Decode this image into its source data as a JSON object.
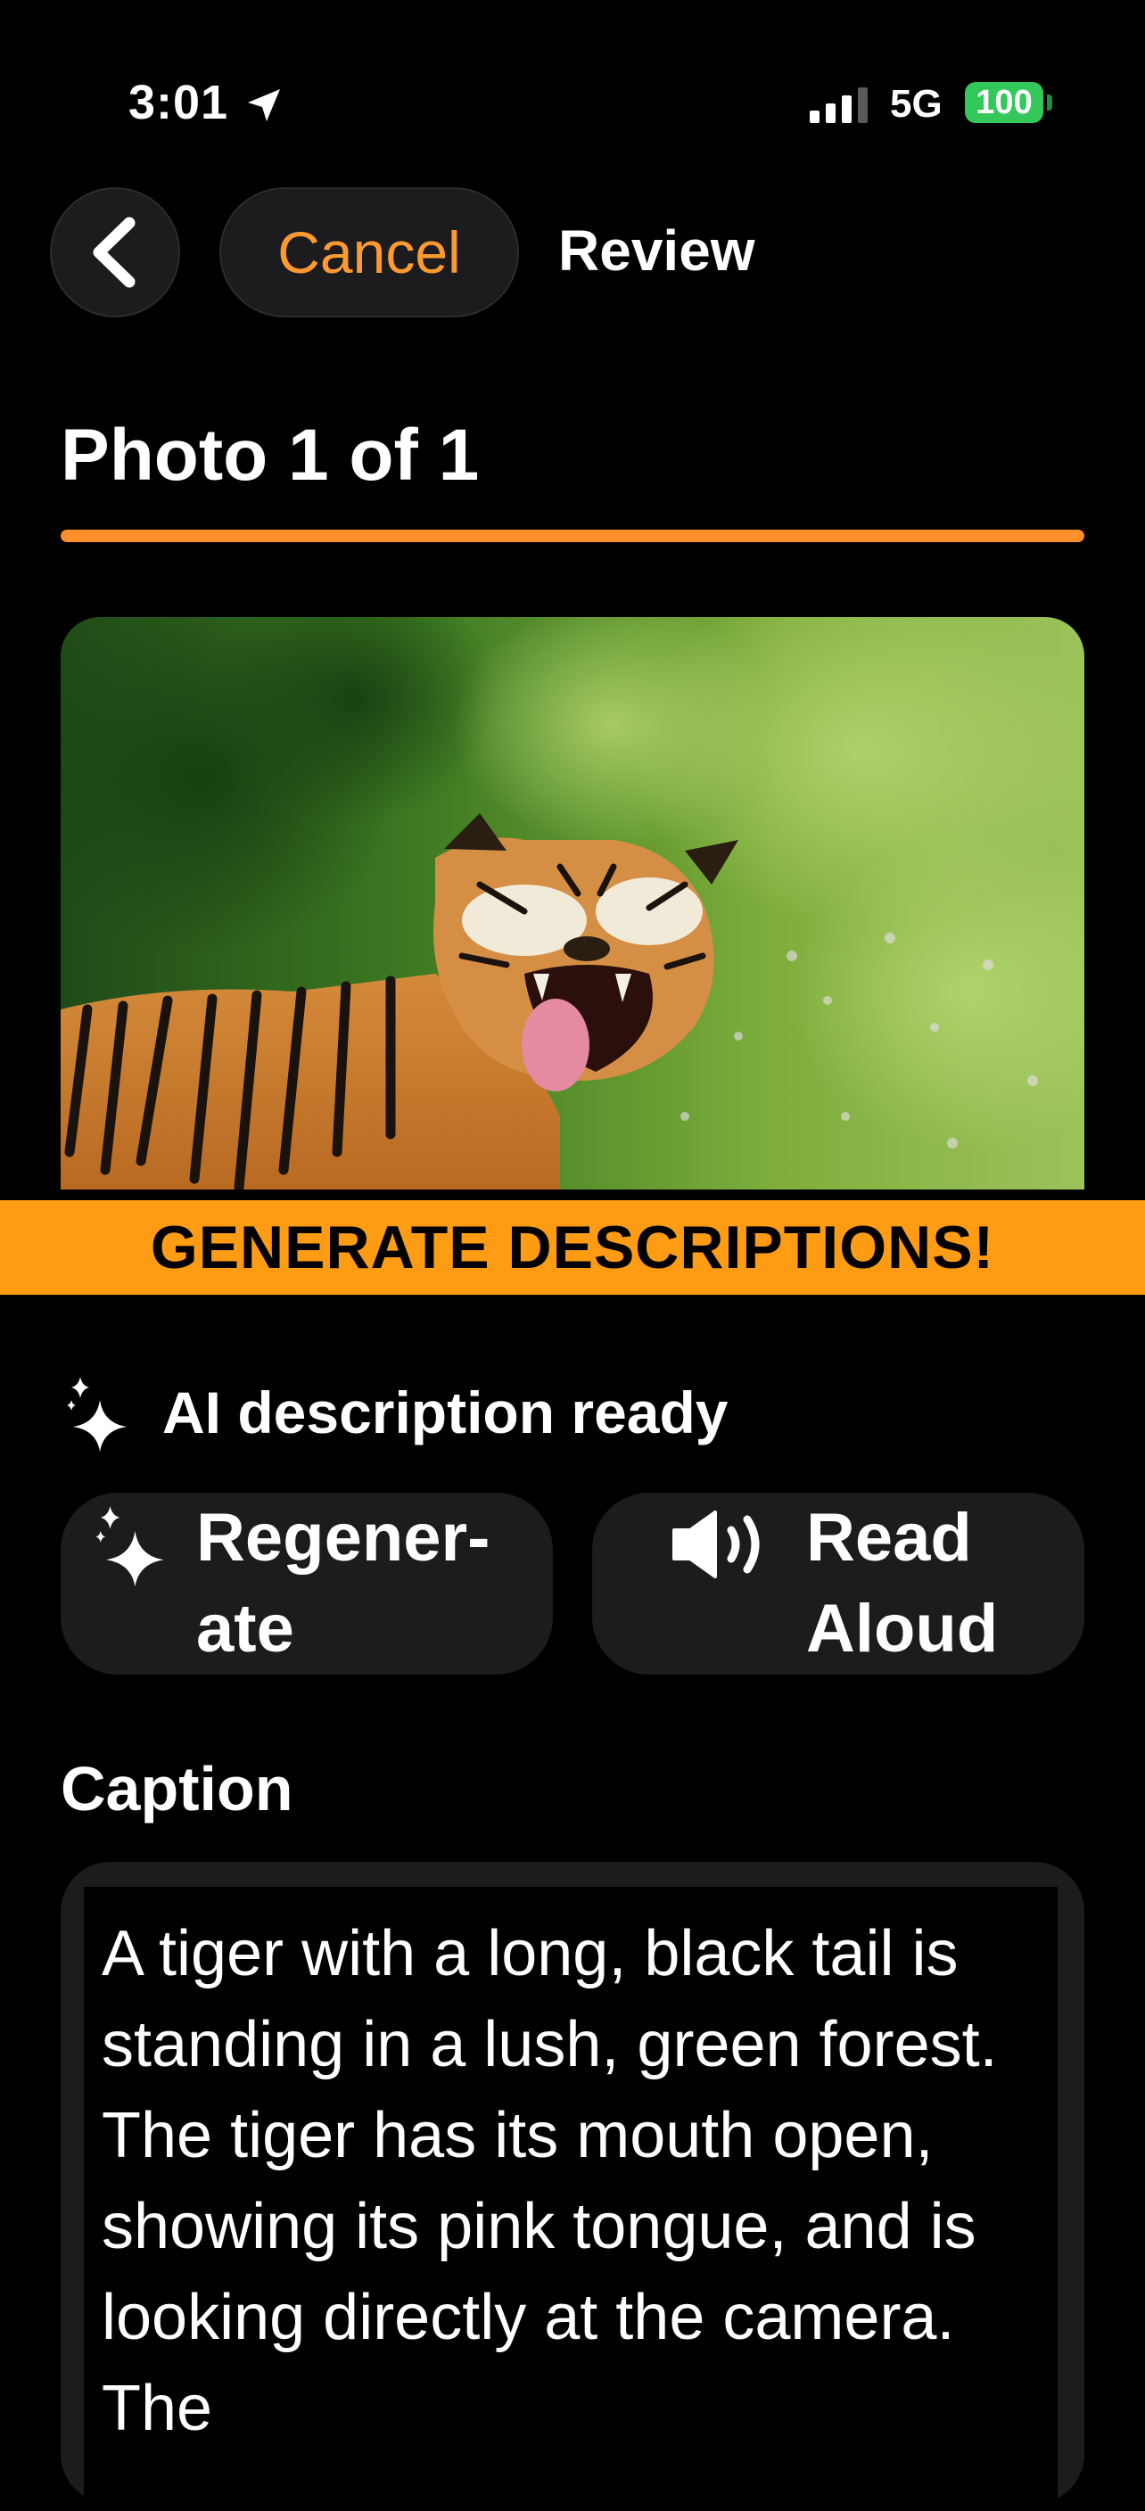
{
  "status_bar": {
    "time": "3:01",
    "location_icon": "location-arrow-icon",
    "signal_icon": "cellular-signal-icon",
    "network": "5G",
    "battery": "100",
    "battery_color": "#34c759"
  },
  "nav": {
    "back_icon": "chevron-left-icon",
    "cancel_label": "Cancel",
    "title": "Review",
    "accent_color": "#ff9a2f"
  },
  "section": {
    "heading": "Photo 1 of 1",
    "progress": 1.0
  },
  "photo": {
    "subject": "tiger-photo"
  },
  "banner": {
    "text": "GENERATE DESCRIPTIONS!",
    "color": "#ff9c13"
  },
  "ai": {
    "status_icon": "sparkles-icon",
    "status_text": "AI description ready"
  },
  "actions": {
    "regenerate": {
      "icon": "sparkles-icon",
      "label": "Regener-\nate"
    },
    "read_aloud": {
      "icon": "speaker-wave-icon",
      "label": "Read\nAloud"
    }
  },
  "caption": {
    "label": "Caption",
    "value": "A tiger with a long, black tail is standing in a lush, green forest. The tiger has its mouth open, showing its pink tongue, and is looking directly at the camera. The"
  }
}
